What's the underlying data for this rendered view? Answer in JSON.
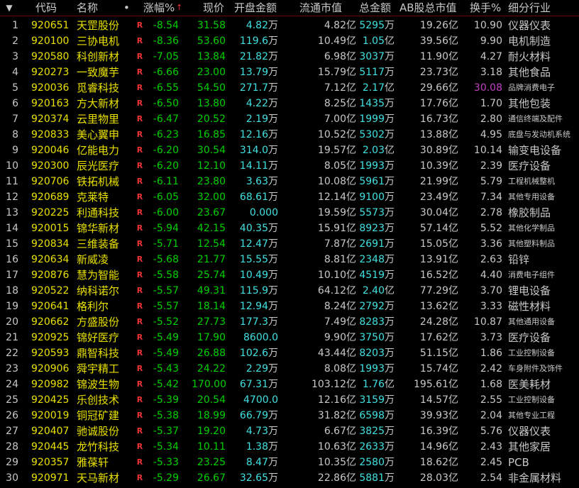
{
  "header": {
    "sort_icon": "▼",
    "code": "代码",
    "name": "名称",
    "dot": "•",
    "change_pct": "涨幅%",
    "change_arrow": "↑",
    "price": "现价",
    "open_amount": "开盘金额",
    "float_cap": "流通市值",
    "total_amount": "总金额",
    "ab_total_cap": "AB股总市值",
    "turnover": "换手%",
    "industry": "细分行业"
  },
  "r_marker": "R",
  "rows": [
    {
      "idx": "1",
      "code": "920651",
      "name": "天罡股份",
      "chg": "-8.54",
      "price": "31.58",
      "open": "4.82",
      "open_unit": "万",
      "float": "4.82亿",
      "total": "5295",
      "total_unit": "万",
      "ab": "19.26亿",
      "turn": "10.90",
      "ind": "仪器仪表",
      "ind_small": false,
      "turn_hl": false
    },
    {
      "idx": "2",
      "code": "920100",
      "name": "三协电机",
      "chg": "-8.36",
      "price": "53.60",
      "open": "119.6",
      "open_unit": "万",
      "float": "10.49亿",
      "total": "1.05",
      "total_unit": "亿",
      "ab": "39.56亿",
      "turn": "9.90",
      "ind": "电机制造",
      "ind_small": false,
      "turn_hl": false
    },
    {
      "idx": "3",
      "code": "920580",
      "name": "科创新材",
      "chg": "-7.05",
      "price": "13.84",
      "open": "21.82",
      "open_unit": "万",
      "float": "6.98亿",
      "total": "3037",
      "total_unit": "万",
      "ab": "11.90亿",
      "turn": "4.27",
      "ind": "耐火材料",
      "ind_small": false,
      "turn_hl": false
    },
    {
      "idx": "4",
      "code": "920273",
      "name": "一致魔芋",
      "chg": "-6.66",
      "price": "23.00",
      "open": "13.79",
      "open_unit": "万",
      "float": "15.79亿",
      "total": "5117",
      "total_unit": "万",
      "ab": "23.73亿",
      "turn": "3.18",
      "ind": "其他食品",
      "ind_small": false,
      "turn_hl": false
    },
    {
      "idx": "5",
      "code": "920036",
      "name": "觅睿科技",
      "chg": "-6.55",
      "price": "54.50",
      "open": "271.7",
      "open_unit": "万",
      "float": "7.12亿",
      "total": "2.17",
      "total_unit": "亿",
      "ab": "29.66亿",
      "turn": "30.08",
      "ind": "品牌消费电子",
      "ind_small": true,
      "turn_hl": true
    },
    {
      "idx": "6",
      "code": "920163",
      "name": "方大新材",
      "chg": "-6.50",
      "price": "13.80",
      "open": "4.22",
      "open_unit": "万",
      "float": "8.25亿",
      "total": "1435",
      "total_unit": "万",
      "ab": "17.76亿",
      "turn": "1.70",
      "ind": "其他包装",
      "ind_small": false,
      "turn_hl": false
    },
    {
      "idx": "7",
      "code": "920374",
      "name": "云里物里",
      "chg": "-6.47",
      "price": "20.52",
      "open": "2.19",
      "open_unit": "万",
      "float": "7.00亿",
      "total": "1999",
      "total_unit": "万",
      "ab": "16.73亿",
      "turn": "2.80",
      "ind": "通信终端及配件",
      "ind_small": true,
      "turn_hl": false
    },
    {
      "idx": "8",
      "code": "920833",
      "name": "美心翼申",
      "chg": "-6.23",
      "price": "16.85",
      "open": "12.16",
      "open_unit": "万",
      "float": "10.52亿",
      "total": "5302",
      "total_unit": "万",
      "ab": "13.88亿",
      "turn": "4.95",
      "ind": "底盘与发动机系统",
      "ind_small": true,
      "turn_hl": false
    },
    {
      "idx": "9",
      "code": "920046",
      "name": "亿能电力",
      "chg": "-6.20",
      "price": "30.54",
      "open": "314.0",
      "open_unit": "万",
      "float": "19.57亿",
      "total": "2.03",
      "total_unit": "亿",
      "ab": "30.89亿",
      "turn": "10.14",
      "ind": "输变电设备",
      "ind_small": false,
      "turn_hl": false
    },
    {
      "idx": "10",
      "code": "920300",
      "name": "辰光医疗",
      "chg": "-6.20",
      "price": "12.10",
      "open": "14.11",
      "open_unit": "万",
      "float": "8.05亿",
      "total": "1993",
      "total_unit": "万",
      "ab": "10.39亿",
      "turn": "2.39",
      "ind": "医疗设备",
      "ind_small": false,
      "turn_hl": false
    },
    {
      "idx": "11",
      "code": "920706",
      "name": "铁拓机械",
      "chg": "-6.11",
      "price": "23.80",
      "open": "3.63",
      "open_unit": "万",
      "float": "10.08亿",
      "total": "5961",
      "total_unit": "万",
      "ab": "21.99亿",
      "turn": "5.79",
      "ind": "工程机械整机",
      "ind_small": true,
      "turn_hl": false
    },
    {
      "idx": "12",
      "code": "920689",
      "name": "克莱特",
      "chg": "-6.05",
      "price": "32.00",
      "open": "68.61",
      "open_unit": "万",
      "float": "12.14亿",
      "total": "9100",
      "total_unit": "万",
      "ab": "23.49亿",
      "turn": "7.34",
      "ind": "其他专用设备",
      "ind_small": true,
      "turn_hl": false
    },
    {
      "idx": "13",
      "code": "920225",
      "name": "利通科技",
      "chg": "-6.00",
      "price": "23.67",
      "open": "0.000",
      "open_unit": "",
      "float": "19.59亿",
      "total": "5573",
      "total_unit": "万",
      "ab": "30.04亿",
      "turn": "2.78",
      "ind": "橡胶制品",
      "ind_small": false,
      "turn_hl": false
    },
    {
      "idx": "14",
      "code": "920015",
      "name": "锦华新材",
      "chg": "-5.94",
      "price": "42.15",
      "open": "40.35",
      "open_unit": "万",
      "float": "15.91亿",
      "total": "8923",
      "total_unit": "万",
      "ab": "57.14亿",
      "turn": "5.52",
      "ind": "其他化学制品",
      "ind_small": true,
      "turn_hl": false
    },
    {
      "idx": "15",
      "code": "920834",
      "name": "三维装备",
      "chg": "-5.71",
      "price": "12.54",
      "open": "12.47",
      "open_unit": "万",
      "float": "7.87亿",
      "total": "2691",
      "total_unit": "万",
      "ab": "15.05亿",
      "turn": "3.36",
      "ind": "其他塑料制品",
      "ind_small": true,
      "turn_hl": false
    },
    {
      "idx": "16",
      "code": "920634",
      "name": "新威凌",
      "chg": "-5.68",
      "price": "21.77",
      "open": "15.55",
      "open_unit": "万",
      "float": "8.81亿",
      "total": "2348",
      "total_unit": "万",
      "ab": "13.91亿",
      "turn": "2.63",
      "ind": "铅锌",
      "ind_small": false,
      "turn_hl": false
    },
    {
      "idx": "17",
      "code": "920876",
      "name": "慧为智能",
      "chg": "-5.58",
      "price": "25.74",
      "open": "10.49",
      "open_unit": "万",
      "float": "10.10亿",
      "total": "4519",
      "total_unit": "万",
      "ab": "16.52亿",
      "turn": "4.40",
      "ind": "消费电子组件",
      "ind_small": true,
      "turn_hl": false
    },
    {
      "idx": "18",
      "code": "920522",
      "name": "纳科诺尔",
      "chg": "-5.57",
      "price": "49.31",
      "open": "115.9",
      "open_unit": "万",
      "float": "64.12亿",
      "total": "2.40",
      "total_unit": "亿",
      "ab": "77.29亿",
      "turn": "3.70",
      "ind": "锂电设备",
      "ind_small": false,
      "turn_hl": false
    },
    {
      "idx": "19",
      "code": "920641",
      "name": "格利尔",
      "chg": "-5.57",
      "price": "18.14",
      "open": "12.94",
      "open_unit": "万",
      "float": "8.24亿",
      "total": "2792",
      "total_unit": "万",
      "ab": "13.62亿",
      "turn": "3.33",
      "ind": "磁性材料",
      "ind_small": false,
      "turn_hl": false
    },
    {
      "idx": "20",
      "code": "920662",
      "name": "方盛股份",
      "chg": "-5.52",
      "price": "27.73",
      "open": "177.3",
      "open_unit": "万",
      "float": "7.49亿",
      "total": "8283",
      "total_unit": "万",
      "ab": "24.28亿",
      "turn": "10.87",
      "ind": "其他通用设备",
      "ind_small": true,
      "turn_hl": false
    },
    {
      "idx": "21",
      "code": "920925",
      "name": "锦好医疗",
      "chg": "-5.49",
      "price": "17.90",
      "open": "8600.0",
      "open_unit": "",
      "float": "9.90亿",
      "total": "3750",
      "total_unit": "万",
      "ab": "17.62亿",
      "turn": "3.73",
      "ind": "医疗设备",
      "ind_small": false,
      "turn_hl": false
    },
    {
      "idx": "22",
      "code": "920593",
      "name": "鼎智科技",
      "chg": "-5.49",
      "price": "26.88",
      "open": "102.6",
      "open_unit": "万",
      "float": "43.44亿",
      "total": "8203",
      "total_unit": "万",
      "ab": "51.15亿",
      "turn": "1.86",
      "ind": "工业控制设备",
      "ind_small": true,
      "turn_hl": false
    },
    {
      "idx": "23",
      "code": "920906",
      "name": "舜宇精工",
      "chg": "-5.43",
      "price": "24.22",
      "open": "2.29",
      "open_unit": "万",
      "float": "8.08亿",
      "total": "1993",
      "total_unit": "万",
      "ab": "15.74亿",
      "turn": "2.42",
      "ind": "车身附件及饰件",
      "ind_small": true,
      "turn_hl": false
    },
    {
      "idx": "24",
      "code": "920982",
      "name": "锦波生物",
      "chg": "-5.42",
      "price": "170.00",
      "open": "67.31",
      "open_unit": "万",
      "float": "103.12亿",
      "total": "1.76",
      "total_unit": "亿",
      "ab": "195.61亿",
      "turn": "1.68",
      "ind": "医美耗材",
      "ind_small": false,
      "turn_hl": false
    },
    {
      "idx": "25",
      "code": "920425",
      "name": "乐创技术",
      "chg": "-5.39",
      "price": "20.54",
      "open": "4700.0",
      "open_unit": "",
      "float": "12.16亿",
      "total": "3159",
      "total_unit": "万",
      "ab": "14.57亿",
      "turn": "2.55",
      "ind": "工业控制设备",
      "ind_small": true,
      "turn_hl": false
    },
    {
      "idx": "26",
      "code": "920019",
      "name": "铜冠矿建",
      "chg": "-5.38",
      "price": "18.99",
      "open": "66.79",
      "open_unit": "万",
      "float": "31.82亿",
      "total": "6598",
      "total_unit": "万",
      "ab": "39.93亿",
      "turn": "2.04",
      "ind": "其他专业工程",
      "ind_small": true,
      "turn_hl": false
    },
    {
      "idx": "27",
      "code": "920407",
      "name": "驰诚股份",
      "chg": "-5.37",
      "price": "19.20",
      "open": "4.73",
      "open_unit": "万",
      "float": "6.67亿",
      "total": "3825",
      "total_unit": "万",
      "ab": "16.39亿",
      "turn": "5.76",
      "ind": "仪器仪表",
      "ind_small": false,
      "turn_hl": false
    },
    {
      "idx": "28",
      "code": "920445",
      "name": "龙竹科技",
      "chg": "-5.34",
      "price": "10.11",
      "open": "1.38",
      "open_unit": "万",
      "float": "10.63亿",
      "total": "2633",
      "total_unit": "万",
      "ab": "14.96亿",
      "turn": "2.43",
      "ind": "其他家居",
      "ind_small": false,
      "turn_hl": false
    },
    {
      "idx": "29",
      "code": "920357",
      "name": "雅葆轩",
      "chg": "-5.33",
      "price": "23.25",
      "open": "8.47",
      "open_unit": "万",
      "float": "10.35亿",
      "total": "2580",
      "total_unit": "万",
      "ab": "18.62亿",
      "turn": "2.45",
      "ind": "PCB",
      "ind_small": false,
      "turn_hl": false
    },
    {
      "idx": "30",
      "code": "920971",
      "name": "天马新材",
      "chg": "-5.29",
      "price": "26.67",
      "open": "32.65",
      "open_unit": "万",
      "float": "22.86亿",
      "total": "5881",
      "total_unit": "万",
      "ab": "28.03亿",
      "turn": "2.54",
      "ind": "非金属材料",
      "ind_small": false,
      "turn_hl": false
    }
  ],
  "colors": {
    "background": "#000000",
    "code_name": "#e8e000",
    "down": "#00d000",
    "amount": "#40e0e0",
    "text": "#c8c8c8",
    "marker": "#e33333",
    "highlight_turnover": "#c040c0"
  }
}
